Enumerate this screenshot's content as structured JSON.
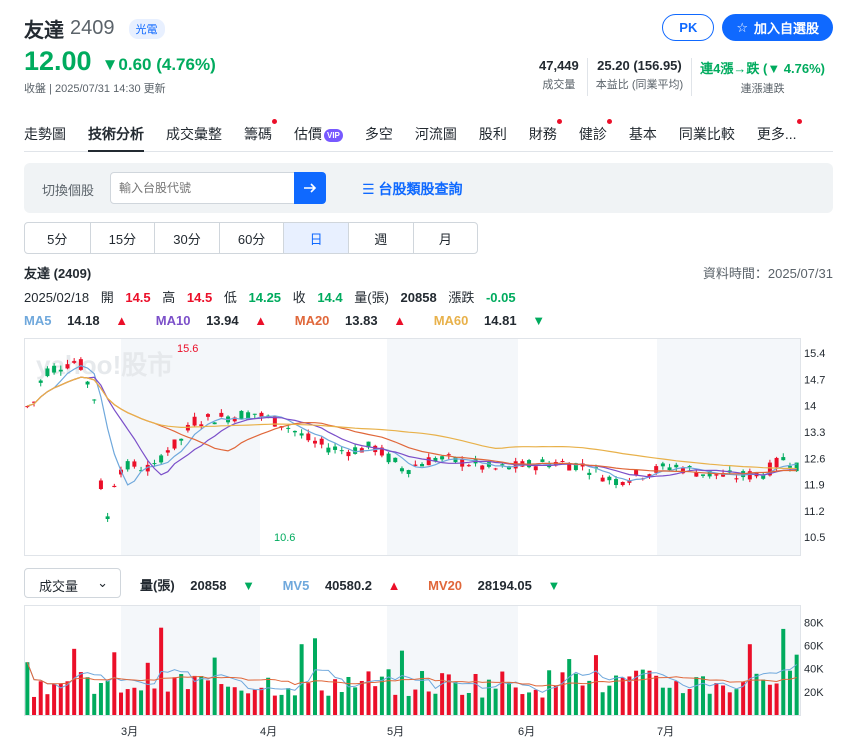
{
  "header": {
    "name": "友達",
    "code": "2409",
    "tag": "光電",
    "price": "12.00",
    "change": "▼0.60 (4.76%)",
    "update": "收盤 | 2025/07/31 14:30 更新"
  },
  "buttons": {
    "pk": "PK",
    "add": "加入自選股"
  },
  "stats": [
    {
      "value": "47,449",
      "label": "成交量"
    },
    {
      "value": "25.20 (156.95)",
      "label": "本益比 (同業平均)"
    },
    {
      "value": "連4漲→跌 (▼ 4.76%)",
      "label": "連漲連跌"
    }
  ],
  "tabs": [
    "走勢圖",
    "技術分析",
    "成交彙整",
    "籌碼",
    "估價",
    "多空",
    "河流圖",
    "股利",
    "財務",
    "健診",
    "基本",
    "同業比較",
    "更多..."
  ],
  "vip": "VIP",
  "search": {
    "label": "切換個股",
    "placeholder": "輸入台股代號",
    "link": "台股類股查詢"
  },
  "periods": [
    "5分",
    "15分",
    "30分",
    "60分",
    "日",
    "週",
    "月"
  ],
  "chart_header": {
    "title": "友達 (2409)",
    "time": "資料時間：2025/07/31"
  },
  "ohlc": {
    "date": "2025/02/18",
    "open_l": "開",
    "open": "14.5",
    "high_l": "高",
    "high": "14.5",
    "low_l": "低",
    "low": "14.25",
    "close_l": "收",
    "close": "14.4",
    "vol_l": "量(張)",
    "vol": "20858",
    "chg_l": "漲跌",
    "chg": "-0.05"
  },
  "ma": [
    {
      "label": "MA5",
      "value": "14.18",
      "dir": "▲",
      "color": "#6fa8dc"
    },
    {
      "label": "MA10",
      "value": "13.94",
      "dir": "▲",
      "color": "#7b4fc9"
    },
    {
      "label": "MA20",
      "value": "13.83",
      "dir": "▲",
      "color": "#e0673a"
    },
    {
      "label": "MA60",
      "value": "14.81",
      "dir": "▼",
      "color": "#e8b14a"
    }
  ],
  "vol_select": "成交量",
  "vol_info": [
    {
      "label": "量(張)",
      "value": "20858",
      "dir": "▼",
      "color": "#232a31"
    },
    {
      "label": "MV5",
      "value": "40580.2",
      "dir": "▲",
      "color": "#6fa8dc"
    },
    {
      "label": "MV20",
      "value": "28194.05",
      "dir": "▼",
      "color": "#e0673a"
    }
  ],
  "chart_data": {
    "type": "candlestick",
    "y_ticks": [
      "15.4",
      "14.7",
      "14",
      "13.3",
      "12.6",
      "11.9",
      "11.2",
      "10.5"
    ],
    "y_range": [
      10.0,
      15.8
    ],
    "max_label": "15.6",
    "min_label": "10.6",
    "vol_ticks": [
      "80K",
      "60K",
      "40K",
      "20K"
    ],
    "vol_range": [
      0,
      95000
    ],
    "months": [
      "3月",
      "4月",
      "5月",
      "6月",
      "7月"
    ],
    "watermark": "yahoo!股市"
  }
}
